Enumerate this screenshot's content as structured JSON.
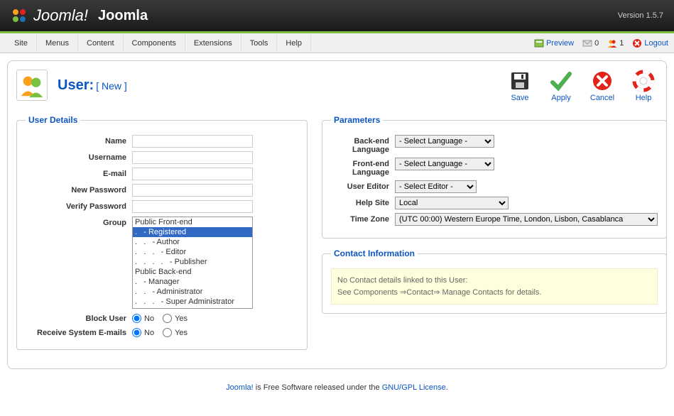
{
  "header": {
    "logo_text": "Joomla!",
    "site_name": "Joomla",
    "version": "Version 1.5.7"
  },
  "menubar": {
    "items": [
      "Site",
      "Menus",
      "Content",
      "Components",
      "Extensions",
      "Tools",
      "Help"
    ],
    "preview": "Preview",
    "msg_count": "0",
    "user_count": "1",
    "logout": "Logout"
  },
  "page": {
    "title_prefix": "User:",
    "title_suffix": "[ New ]"
  },
  "toolbar": {
    "save": "Save",
    "apply": "Apply",
    "cancel": "Cancel",
    "help": "Help"
  },
  "userDetails": {
    "legend": "User Details",
    "name_label": "Name",
    "name_value": "",
    "username_label": "Username",
    "username_value": "",
    "email_label": "E-mail",
    "email_value": "",
    "newpass_label": "New Password",
    "newpass_value": "",
    "vpass_label": "Verify Password",
    "vpass_value": "",
    "group_label": "Group",
    "group_options": [
      {
        "text": "Public Front-end",
        "indent": 0,
        "selected": false
      },
      {
        "text": "- Registered",
        "indent": 1,
        "selected": true
      },
      {
        "text": "- Author",
        "indent": 2,
        "selected": false
      },
      {
        "text": "- Editor",
        "indent": 3,
        "selected": false
      },
      {
        "text": "- Publisher",
        "indent": 4,
        "selected": false
      },
      {
        "text": "Public Back-end",
        "indent": 0,
        "selected": false
      },
      {
        "text": "- Manager",
        "indent": 1,
        "selected": false
      },
      {
        "text": "- Administrator",
        "indent": 2,
        "selected": false
      },
      {
        "text": "- Super Administrator",
        "indent": 3,
        "selected": false
      }
    ],
    "block_label": "Block User",
    "block_no": "No",
    "block_yes": "Yes",
    "block_value": "no",
    "receive_label": "Receive System E-mails",
    "receive_no": "No",
    "receive_yes": "Yes",
    "receive_value": "no"
  },
  "parameters": {
    "legend": "Parameters",
    "backend_label": "Back-end Language",
    "backend_value": "- Select Language -",
    "frontend_label": "Front-end Language",
    "frontend_value": "- Select Language -",
    "editor_label": "User Editor",
    "editor_value": "- Select Editor -",
    "helpsite_label": "Help Site",
    "helpsite_value": "Local",
    "timezone_label": "Time Zone",
    "timezone_value": "(UTC 00:00) Western Europe Time, London, Lisbon, Casablanca"
  },
  "contact": {
    "legend": "Contact Information",
    "line1": "No Contact details linked to this User:",
    "line2": "See Components ⇒Contact⇒ Manage Contacts for details."
  },
  "footer": {
    "prefix": "Joomla!",
    "mid": " is Free Software released under the ",
    "link": "GNU/GPL License",
    "suffix": "."
  }
}
